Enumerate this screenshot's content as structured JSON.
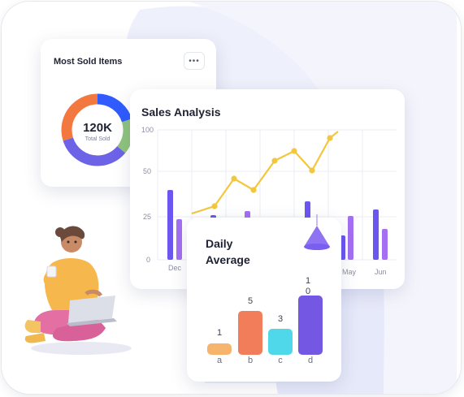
{
  "most_sold": {
    "title": "Most Sold Items",
    "menu_icon": "more-horizontal-icon",
    "total_value": "120K",
    "total_label": "Total Sold",
    "segments": [
      {
        "name": "blue",
        "fraction": 0.2,
        "color": "#2f5bff"
      },
      {
        "name": "green",
        "fraction": 0.16,
        "color": "#8fc47d"
      },
      {
        "name": "purple",
        "fraction": 0.34,
        "color": "#6c63e6"
      },
      {
        "name": "orange",
        "fraction": 0.3,
        "color": "#f2783f"
      }
    ]
  },
  "sales": {
    "title": "Sales Analysis",
    "y_ticks": [
      "100",
      "50",
      "25",
      "0"
    ],
    "months": [
      "Dec",
      "May",
      "Jun"
    ]
  },
  "daily": {
    "title_line1": "Daily",
    "title_line2": "Average",
    "bars": [
      {
        "label": "a",
        "value": "1",
        "color": "#f6b46c"
      },
      {
        "label": "b",
        "value": "5",
        "color": "#f17d5a"
      },
      {
        "label": "c",
        "value": "3",
        "color": "#4fd8ea"
      },
      {
        "label": "d",
        "value": "10",
        "color": "#7458e4"
      }
    ]
  },
  "colors": {
    "accent_purple": "#7a5ef0",
    "line_yellow": "#f3c73d",
    "bar_violet": "#6b56ef",
    "bar_lilac": "#a46ff3"
  }
}
